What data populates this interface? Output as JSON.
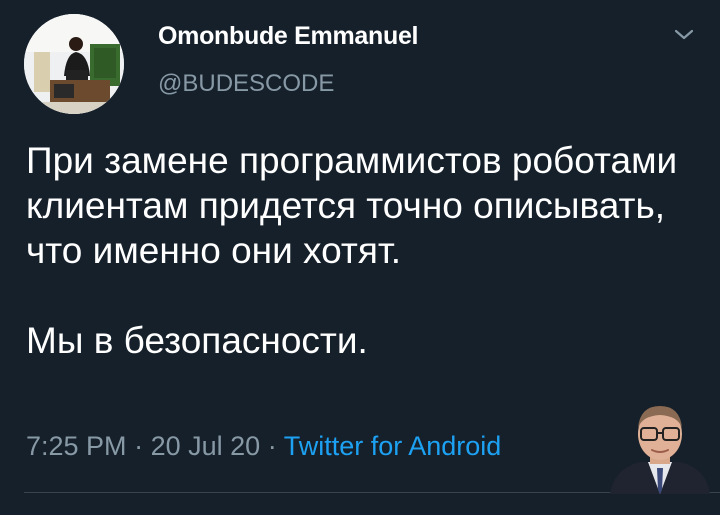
{
  "user": {
    "display_name": "Omonbude Emmanuel",
    "handle": "@BUDESCODE",
    "avatar_icon": "profile-photo"
  },
  "tweet": {
    "paragraph_1": "При замене программистов роботами клиентам придется точно описывать, что именно они хотят.",
    "paragraph_2": "Мы в безопасности.",
    "time": "7:25 PM",
    "separator": "·",
    "date": "20 Jul 20",
    "source": "Twitter for Android"
  },
  "icons": {
    "menu": "chevron-down-icon",
    "sticker": "bill-gates-sticker"
  },
  "colors": {
    "background": "#15202b",
    "primary_text": "#ffffff",
    "secondary_text": "#8899a6",
    "link": "#1da1f2",
    "divider": "#38444d"
  }
}
